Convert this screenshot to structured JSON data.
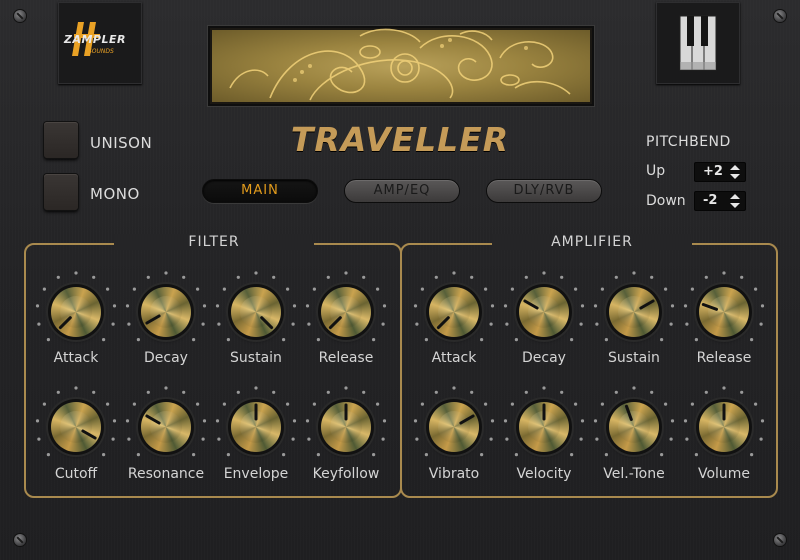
{
  "brand": {
    "logo_text": "ZAMPLER",
    "logo_sub": "SOUNDS",
    "accent": "#e9a125"
  },
  "product_title": "TRAVELLER",
  "toggles": [
    {
      "label": "UNISON"
    },
    {
      "label": "MONO"
    }
  ],
  "tabs": [
    {
      "label": "MAIN",
      "active": true
    },
    {
      "label": "AMP/EQ",
      "active": false
    },
    {
      "label": "DLY/RVB",
      "active": false
    }
  ],
  "pitchbend": {
    "title": "PITCHBEND",
    "up_label": "Up",
    "up_value": "+2",
    "down_label": "Down",
    "down_value": "-2"
  },
  "filter": {
    "title": "FILTER",
    "row1": [
      {
        "label": "Attack",
        "angle": -135
      },
      {
        "label": "Decay",
        "angle": -120
      },
      {
        "label": "Sustain",
        "angle": 135
      },
      {
        "label": "Release",
        "angle": -135
      }
    ],
    "row2": [
      {
        "label": "Cutoff",
        "angle": 120
      },
      {
        "label": "Resonance",
        "angle": -60
      },
      {
        "label": "Envelope",
        "angle": 0
      },
      {
        "label": "Keyfollow",
        "angle": 0
      }
    ]
  },
  "amplifier": {
    "title": "AMPLIFIER",
    "row1": [
      {
        "label": "Attack",
        "angle": -135
      },
      {
        "label": "Decay",
        "angle": -60
      },
      {
        "label": "Sustain",
        "angle": 60
      },
      {
        "label": "Release",
        "angle": -70
      }
    ],
    "row2": [
      {
        "label": "Vibrato",
        "angle": 60
      },
      {
        "label": "Velocity",
        "angle": 0
      },
      {
        "label": "Vel.-Tone",
        "angle": -20
      },
      {
        "label": "Volume",
        "angle": 0
      }
    ]
  },
  "colors": {
    "title": "#c59b58",
    "section_border": "#a98a4e",
    "active_tab_text": "#e29b1c",
    "panel": "#252527"
  }
}
